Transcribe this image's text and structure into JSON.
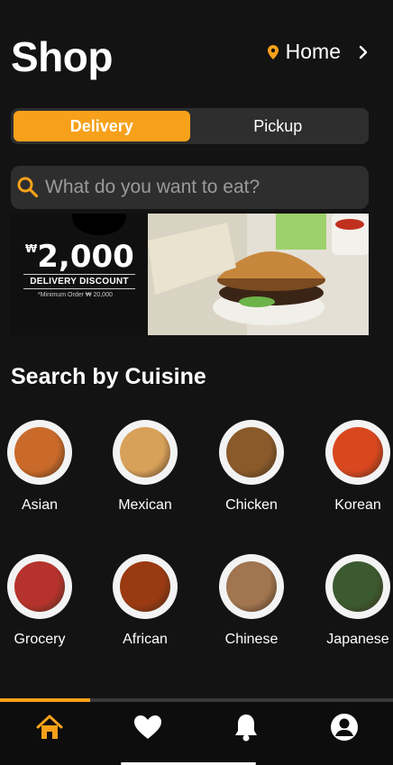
{
  "header": {
    "title": "Shop",
    "location": "Home"
  },
  "segment": {
    "options": [
      "Delivery",
      "Pickup"
    ],
    "active": "Delivery"
  },
  "search": {
    "placeholder": "What do you want to eat?"
  },
  "banner": {
    "currency": "₩",
    "amount": "2,000",
    "label": "DELIVERY DISCOUNT",
    "note": "*Minimum Order ₩ 20,000"
  },
  "section": {
    "title": "Search by Cuisine"
  },
  "cuisines": [
    {
      "name": "Asian",
      "color": "#c96a2a"
    },
    {
      "name": "Mexican",
      "color": "#d8a15a"
    },
    {
      "name": "Chicken",
      "color": "#8a5a2a"
    },
    {
      "name": "Korean",
      "color": "#d9471f"
    },
    {
      "name": "Grocery",
      "color": "#b5332c"
    },
    {
      "name": "African",
      "color": "#9a3a12"
    },
    {
      "name": "Chinese",
      "color": "#a07550"
    },
    {
      "name": "Japanese",
      "color": "#3b5a30"
    }
  ],
  "carousel": {
    "progress": 0.23
  },
  "colors": {
    "accent": "#f7a11a",
    "background": "#131313",
    "surface": "#2e2e2e"
  },
  "tabs": [
    "home-icon",
    "heart-icon",
    "bell-icon",
    "profile-icon"
  ]
}
